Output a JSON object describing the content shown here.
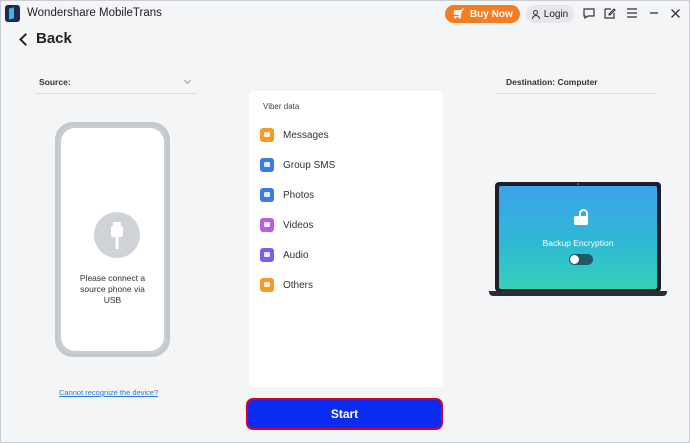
{
  "app": {
    "title": "Wondershare MobileTrans"
  },
  "titlebar": {
    "buy_label": "Buy Now",
    "login_label": "Login",
    "icons": [
      "feedback-icon",
      "edit-icon",
      "menu-icon",
      "minimize-icon",
      "close-icon"
    ]
  },
  "back_label": "Back",
  "source": {
    "label": "Source:",
    "phone_message": "Please connect a source phone via USB",
    "cannot_recognize_link": "Cannot recognize the device?"
  },
  "data_panel": {
    "title": "Viber data",
    "items": [
      {
        "label": "Messages",
        "icon": "messages-icon",
        "color": "#f59a23"
      },
      {
        "label": "Group SMS",
        "icon": "group-sms-icon",
        "color": "#3a7bea"
      },
      {
        "label": "Photos",
        "icon": "photos-icon",
        "color": "#3a7bea"
      },
      {
        "label": "Videos",
        "icon": "videos-icon",
        "color": "#b85ee8"
      },
      {
        "label": "Audio",
        "icon": "audio-icon",
        "color": "#7d5cf0"
      },
      {
        "label": "Others",
        "icon": "others-icon",
        "color": "#f59a23"
      }
    ]
  },
  "start_label": "Start",
  "destination": {
    "label": "Destination: Computer",
    "encryption_label": "Backup Encryption",
    "encryption_enabled": false
  },
  "colors": {
    "accent_orange": "#f57c23",
    "start_blue": "#0a2cf0",
    "start_border": "#d6002a",
    "link_blue": "#2a7ad8"
  }
}
